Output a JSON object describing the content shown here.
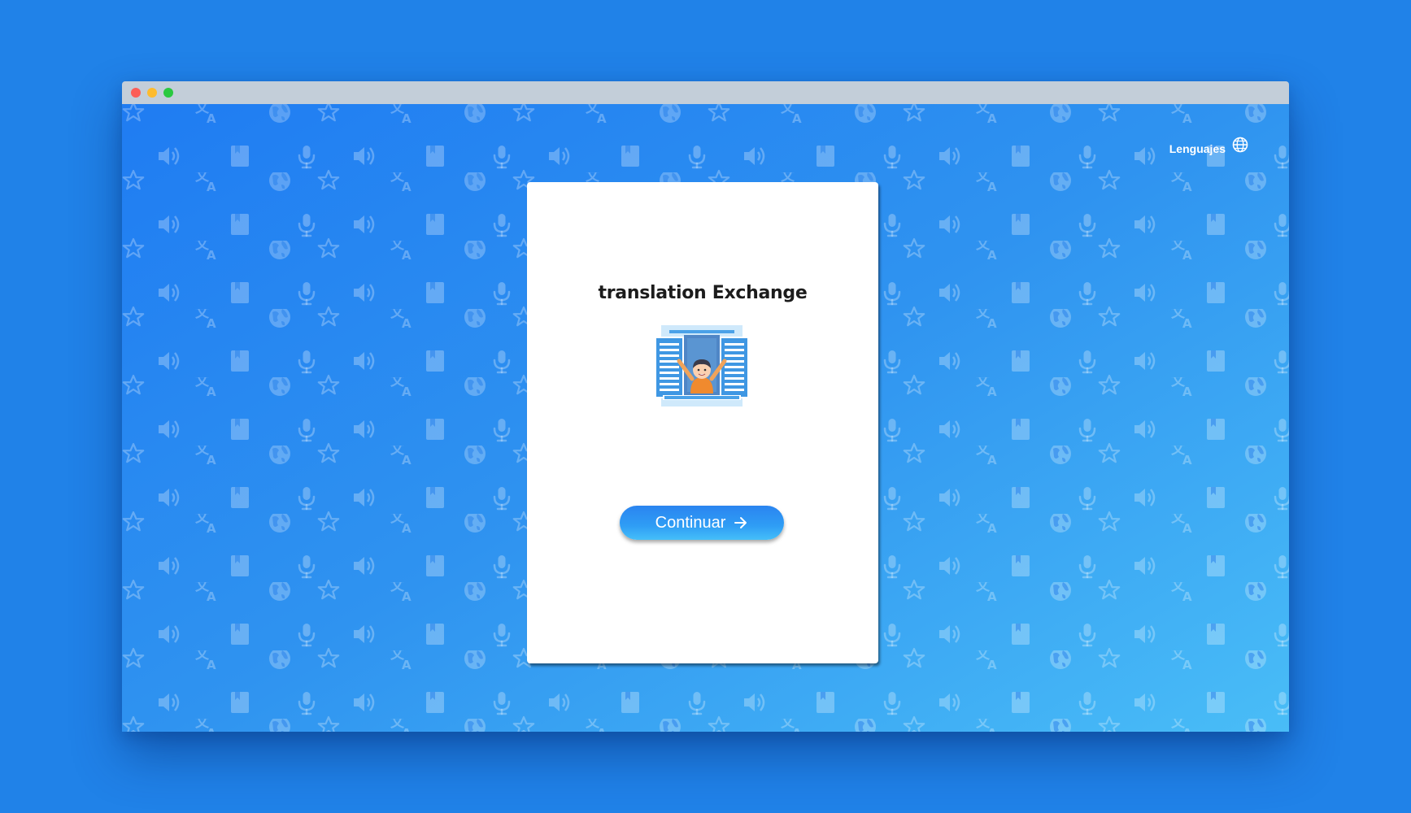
{
  "window": {
    "controls": [
      "close",
      "minimize",
      "zoom"
    ]
  },
  "header": {
    "language_label": "Lenguajes",
    "language_icon": "globe-icon"
  },
  "card": {
    "title": "translation Exchange",
    "illustration": "window-person-illustration",
    "continue_label": "Continuar",
    "continue_icon": "arrow-right-icon"
  },
  "background": {
    "pattern_icons": [
      "star-icon",
      "translate-icon",
      "globe-icon",
      "speaker-icon",
      "book-icon",
      "microphone-icon"
    ]
  },
  "colors": {
    "page_background": "#2082e8",
    "gradient_start": "#1f7cf2",
    "gradient_end": "#49bdf7",
    "button": "#2f9ef5",
    "titlebar": "#c3ced9"
  }
}
